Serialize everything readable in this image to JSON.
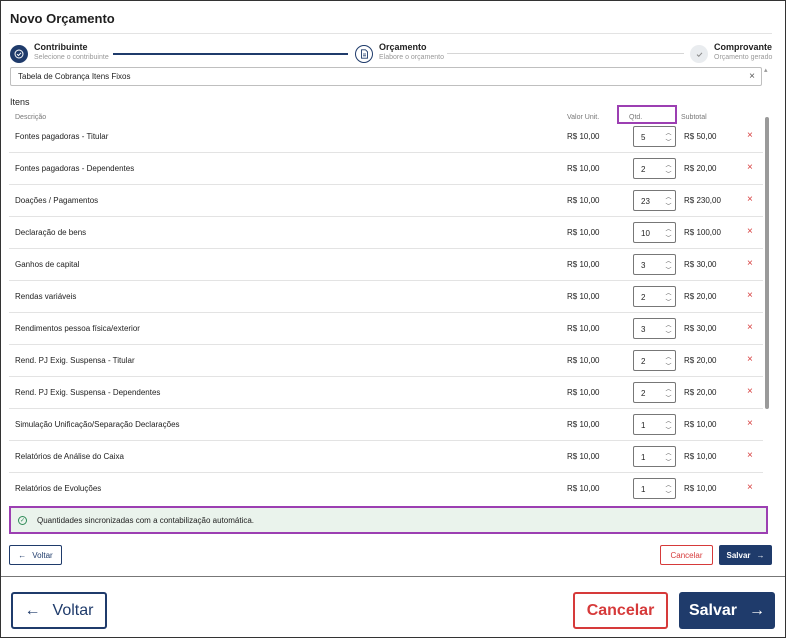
{
  "page_title": "Novo Orçamento",
  "stepper": [
    {
      "label": "Contribuinte",
      "sub": "Selecione o contribuinte"
    },
    {
      "label": "Orçamento",
      "sub": "Elabore o orçamento"
    },
    {
      "label": "Comprovante",
      "sub": "Orçamento gerado"
    }
  ],
  "select": {
    "value": "Tabela de Cobrança Itens Fixos",
    "clear": "×"
  },
  "items_label": "Itens",
  "columns": {
    "descricao": "Descrição",
    "valor_unit": "Valor Unit.",
    "qtd": "Qtd.",
    "subtotal": "Subtotal"
  },
  "rows": [
    {
      "desc": "Fontes pagadoras - Titular",
      "unit": "R$ 10,00",
      "qty": "5",
      "sub": "R$ 50,00"
    },
    {
      "desc": "Fontes pagadoras - Dependentes",
      "unit": "R$ 10,00",
      "qty": "2",
      "sub": "R$ 20,00"
    },
    {
      "desc": "Doações / Pagamentos",
      "unit": "R$ 10,00",
      "qty": "23",
      "sub": "R$ 230,00"
    },
    {
      "desc": "Declaração de bens",
      "unit": "R$ 10,00",
      "qty": "10",
      "sub": "R$ 100,00"
    },
    {
      "desc": "Ganhos de capital",
      "unit": "R$ 10,00",
      "qty": "3",
      "sub": "R$ 30,00"
    },
    {
      "desc": "Rendas variáveis",
      "unit": "R$ 10,00",
      "qty": "2",
      "sub": "R$ 20,00"
    },
    {
      "desc": "Rendimentos pessoa física/exterior",
      "unit": "R$ 10,00",
      "qty": "3",
      "sub": "R$ 30,00"
    },
    {
      "desc": "Rend. PJ Exig. Suspensa - Titular",
      "unit": "R$ 10,00",
      "qty": "2",
      "sub": "R$ 20,00"
    },
    {
      "desc": "Rend. PJ Exig. Suspensa - Dependentes",
      "unit": "R$ 10,00",
      "qty": "2",
      "sub": "R$ 20,00"
    },
    {
      "desc": "Simulação Unificação/Separação Declarações",
      "unit": "R$ 10,00",
      "qty": "1",
      "sub": "R$ 10,00"
    },
    {
      "desc": "Relatórios de Análise do Caixa",
      "unit": "R$ 10,00",
      "qty": "1",
      "sub": "R$ 10,00"
    },
    {
      "desc": "Relatórios de Evoluções",
      "unit": "R$ 10,00",
      "qty": "1",
      "sub": "R$ 10,00"
    }
  ],
  "notice": "Quantidades sincronizadas com a contabilização automática.",
  "buttons": {
    "voltar": "Voltar",
    "cancelar": "Cancelar",
    "salvar": "Salvar"
  },
  "colors": {
    "primary": "#1f3b6b",
    "danger": "#d63a3a",
    "highlight": "#9c3fb2",
    "success_bg": "#eaf3ec"
  }
}
